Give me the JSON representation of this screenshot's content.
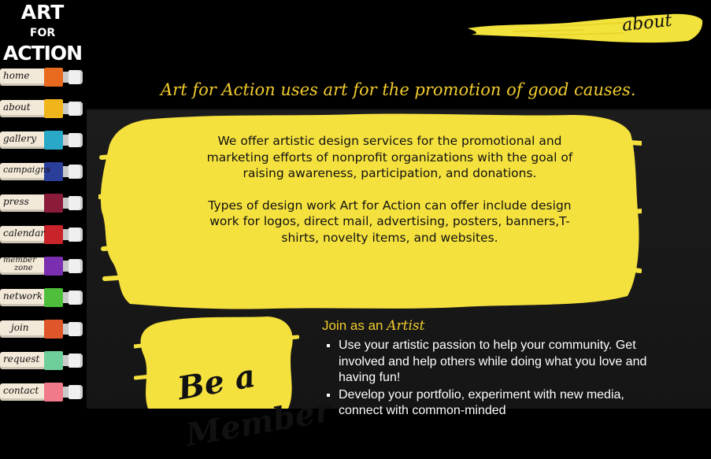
{
  "colors": {
    "accent_yellow": "#f2cc2e",
    "background": "#000000"
  },
  "logo": {
    "line1": "ART",
    "line2": "FOR",
    "line3": "ACTION"
  },
  "nav": [
    {
      "label": "home",
      "color": "#e86a1f"
    },
    {
      "label": "about",
      "color": "#f1b51c"
    },
    {
      "label": "gallery",
      "color": "#2aa8c8"
    },
    {
      "label": "campaigns",
      "color": "#2a3f9a"
    },
    {
      "label": "press",
      "color": "#8a1c3a"
    },
    {
      "label": "calendar",
      "color": "#c8242a"
    },
    {
      "label_line1": "member",
      "label_line2": "zone",
      "color": "#7a2fb0"
    },
    {
      "label": "network",
      "color": "#4fbf3b"
    },
    {
      "label": "join",
      "color": "#e0562b"
    },
    {
      "label": "request",
      "color": "#6fcf9a"
    },
    {
      "label": "contact",
      "color": "#f07a8a"
    }
  ],
  "header": {
    "section_title": "about"
  },
  "tagline": "Art for Action uses art for the promotion of good causes.",
  "main": {
    "paragraph1": "We offer artistic design services for the promotional and marketing efforts of nonprofit organizations with the goal of raising awareness, participation, and donations.",
    "paragraph2": "Types of design work Art for Action can offer include design work for logos, direct mail, advertising, posters, banners,T-shirts, novelty items, and websites."
  },
  "member_sign": {
    "line1": "Be a",
    "line2": "Member"
  },
  "join": {
    "heading_prefix": "Join as an",
    "heading_emphasis": "Artist",
    "items": [
      "Use your artistic passion to help your community. Get involved and help others while doing what you love and having fun!",
      "Develop your portfolio, experiment with new media, connect with common‑minded"
    ]
  }
}
